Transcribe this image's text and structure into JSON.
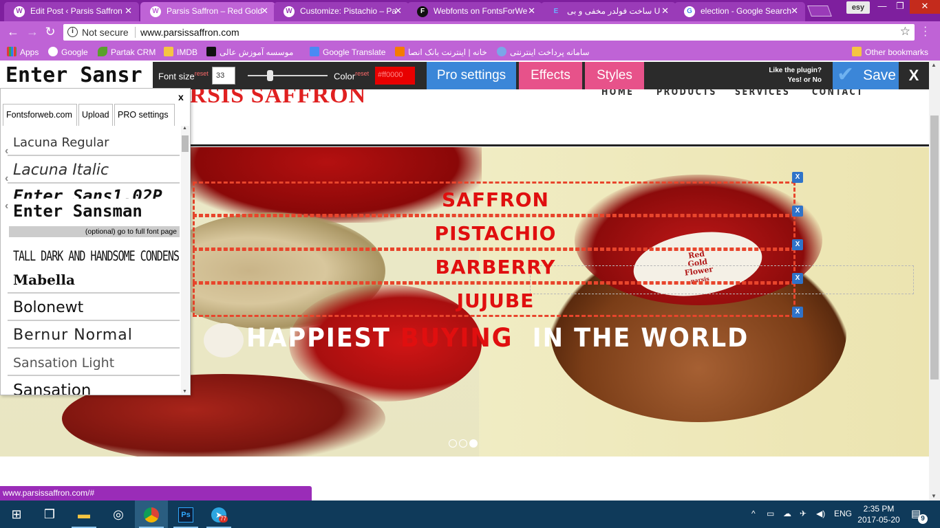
{
  "browser": {
    "tabs": [
      {
        "title": "Edit Post ‹ Parsis Saffron",
        "icon": "wordpress-icon"
      },
      {
        "title": "Parsis Saffron – Red Gold",
        "icon": "wordpress-icon"
      },
      {
        "title": "Customize: Pistachio – Pa",
        "icon": "wordpress-icon"
      },
      {
        "title": "Webfonts on FontsForWe",
        "icon": "fontsforweb-icon"
      },
      {
        "title": "ساخت فولدر مخفی و بی U",
        "icon": "page-icon"
      },
      {
        "title": "election - Google Search",
        "icon": "google-icon"
      }
    ],
    "profile": "esy",
    "security_label": "Not secure",
    "url": "www.parsissaffron.com",
    "bookmarks": [
      {
        "label": "Apps"
      },
      {
        "label": "Google"
      },
      {
        "label": "Partak CRM"
      },
      {
        "label": "IMDB"
      },
      {
        "label": "موسسه آموزش عالی"
      },
      {
        "label": "Google Translate"
      },
      {
        "label": "خانه | اینترنت بانک انصا"
      },
      {
        "label": "سامانه پرداخت اینترنتی"
      }
    ],
    "other_bookmarks": "Other bookmarks",
    "status_url": "www.parsissaffron.com/#"
  },
  "site": {
    "logo": "ARSIS SAFFRON",
    "nav": [
      "HOME",
      "PRODUCTS",
      "SERVICES",
      "CONTACT"
    ],
    "hero_words": [
      "SAFFRON",
      "PISTACHIO",
      "BARBERRY",
      "JUJUBE"
    ],
    "tagline": {
      "part1": "HAPPIEST",
      "part2": "BUYING",
      "part3": "IN THE WORLD"
    },
    "bowl_label": [
      "Red",
      "Gold",
      "Flower",
      "parsis"
    ],
    "remove_label": "X",
    "slider_dots": 3,
    "active_dot": 2
  },
  "plugin": {
    "font_size_label": "Font size",
    "reset_label": "reset",
    "font_size_value": "33",
    "color_label": "Color",
    "color_value": "#ff0000",
    "pro_settings": "Pro settings",
    "effects": "Effects",
    "styles": "Styles",
    "like_q1": "Like the plugin?",
    "like_q2": "Yes! or No",
    "save": "Save",
    "close": "X",
    "preview_text": "Enter Sansr"
  },
  "font_panel": {
    "close": "x",
    "tabs": [
      "Fontsforweb.com",
      "Upload",
      "PRO settings"
    ],
    "fonts": [
      "Lacuna Regular",
      "Lacuna Italic",
      "Enter Sans1.02P",
      "Enter Sansman",
      "TALL DARK AND HANDSOME CONDENSED",
      "Mabella",
      "Bolonewt",
      "Bernur Normal",
      "Sansation Light",
      "Sansation"
    ],
    "optional_link": "(optional) go to full font page"
  },
  "taskbar": {
    "lang": "ENG",
    "time": "2:35 PM",
    "date": "2017-05-20",
    "notifications": "9",
    "telegram_badge": "77"
  },
  "colors": {
    "tab_bar": "#7e1f9e",
    "chrome_bar": "#bf63d6",
    "accent_red": "#e00f0f",
    "plugin_blue": "#3b86d8",
    "plugin_pink": "#e7528a"
  }
}
